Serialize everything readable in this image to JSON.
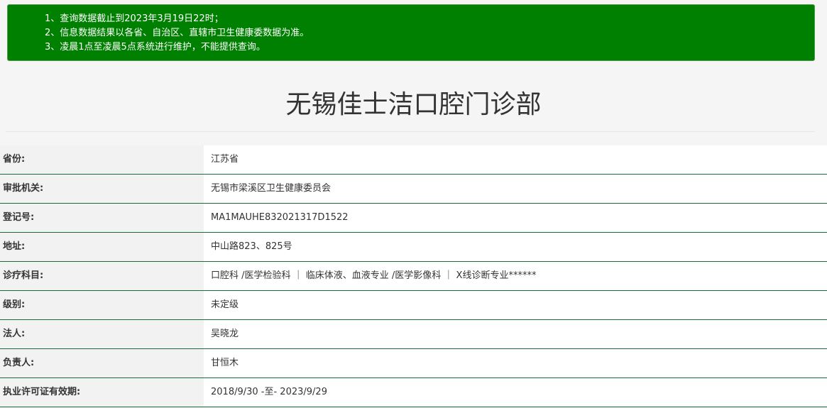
{
  "notice": {
    "lines": [
      "1、查询数据截止到2023年3月19日22时；",
      "2、信息数据结果以各省、自治区、直辖市卫生健康委数据为准。",
      "3、凌晨1点至凌晨5点系统进行维护，不能提供查询。"
    ],
    "bg_color": "#008000"
  },
  "title": "无锡佳士洁口腔门诊部",
  "rows": [
    {
      "label": "省份:",
      "value": "江苏省"
    },
    {
      "label": "审批机关:",
      "value": "无锡市梁溪区卫生健康委员会"
    },
    {
      "label": "登记号:",
      "value": "MA1MAUHE832021317D1522"
    },
    {
      "label": "地址:",
      "value": "中山路823、825号"
    },
    {
      "label": "诊疗科目:",
      "value": "口腔科 /医学检验科 ｜ 临床体液、血液专业 /医学影像科 ｜ X线诊断专业******"
    },
    {
      "label": "级别:",
      "value": "未定级"
    },
    {
      "label": "法人:",
      "value": "吴晓龙"
    },
    {
      "label": "负责人:",
      "value": "甘恒木"
    },
    {
      "label": "执业许可证有效期:",
      "value": "2018/9/30 -至- 2023/9/29"
    }
  ]
}
